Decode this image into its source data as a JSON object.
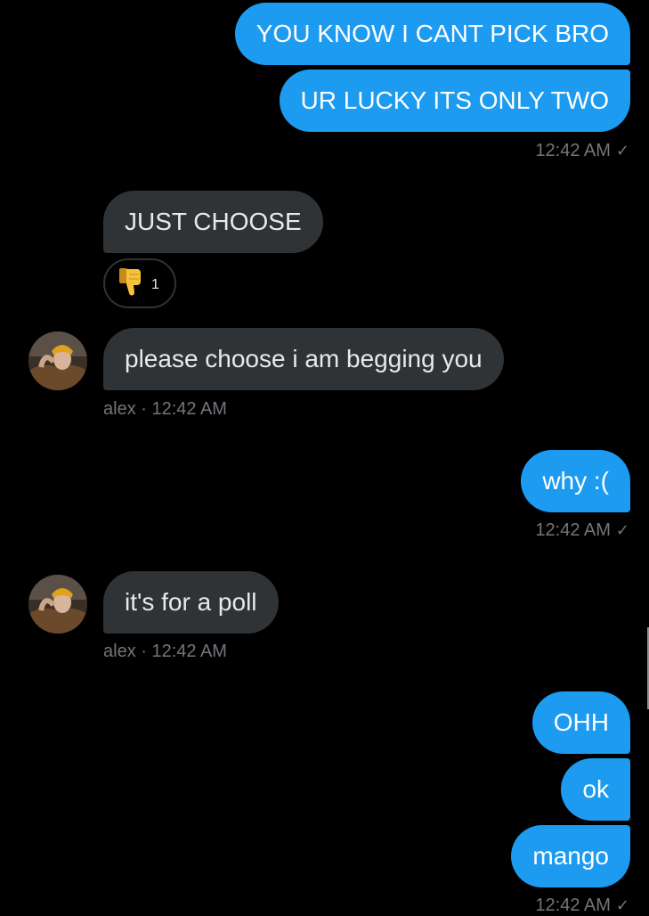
{
  "messages": [
    {
      "id": "m1",
      "direction": "sent",
      "text": "YOU KNOW I CANT PICK BRO"
    },
    {
      "id": "m2",
      "direction": "sent",
      "text": "UR LUCKY ITS ONLY TWO"
    },
    {
      "id": "m3",
      "direction": "received",
      "text": "JUST CHOOSE",
      "reaction": {
        "emoji": "thumbs-down",
        "count": "1"
      }
    },
    {
      "id": "m4",
      "direction": "received",
      "text": "please choose i am begging you"
    },
    {
      "id": "m5",
      "direction": "sent",
      "text": "why :("
    },
    {
      "id": "m6",
      "direction": "received",
      "text": "it's for a poll"
    },
    {
      "id": "m7",
      "direction": "sent",
      "text": "OHH"
    },
    {
      "id": "m8",
      "direction": "sent",
      "text": "ok"
    },
    {
      "id": "m9",
      "direction": "sent",
      "text": "mango"
    }
  ],
  "timestamps": {
    "sent_group_1": "12:42 AM",
    "recv_group_1": "alex · 12:42 AM",
    "sent_group_2": "12:42 AM",
    "recv_group_2": "alex · 12:42 AM",
    "sent_group_3": "12:42 AM"
  },
  "read_indicator": "✓",
  "colors": {
    "background": "#000000",
    "sent_bubble": "#1d9bf0",
    "received_bubble": "#2f3336",
    "meta_text": "#71767b"
  },
  "icons": {
    "reaction": "thumbs-down-icon",
    "read_receipt": "check-icon",
    "avatar": "user-avatar"
  }
}
